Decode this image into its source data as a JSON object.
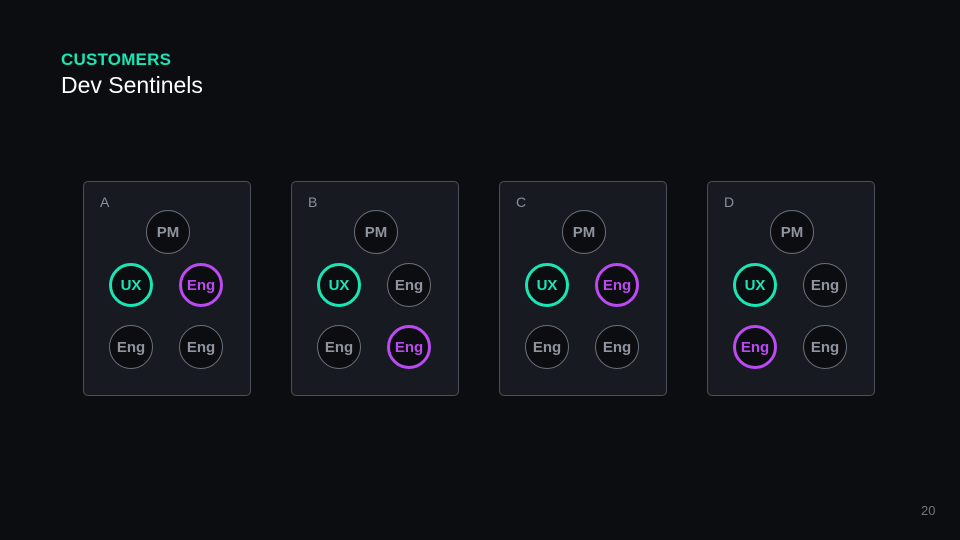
{
  "header": {
    "eyebrow": "CUSTOMERS",
    "title": "Dev Sentinels"
  },
  "colors": {
    "background": "#0c0d10",
    "panel": "#171a21",
    "accent_ux": "#19e6b4",
    "accent_highlight": "#b94bf0",
    "node_default": "#8e959f"
  },
  "panels": [
    {
      "label": "A",
      "pm": "PM",
      "ux": "UX",
      "eng_top": "Eng",
      "eng_bottom_left": "Eng",
      "eng_bottom_right": "Eng",
      "highlighted": "eng_top"
    },
    {
      "label": "B",
      "pm": "PM",
      "ux": "UX",
      "eng_top": "Eng",
      "eng_bottom_left": "Eng",
      "eng_bottom_right": "Eng",
      "highlighted": "eng_bottom_right"
    },
    {
      "label": "C",
      "pm": "PM",
      "ux": "UX",
      "eng_top": "Eng",
      "eng_bottom_left": "Eng",
      "eng_bottom_right": "Eng",
      "highlighted": "eng_top"
    },
    {
      "label": "D",
      "pm": "PM",
      "ux": "UX",
      "eng_top": "Eng",
      "eng_bottom_left": "Eng",
      "eng_bottom_right": "Eng",
      "highlighted": "eng_bottom_left"
    }
  ],
  "page_number": "20"
}
